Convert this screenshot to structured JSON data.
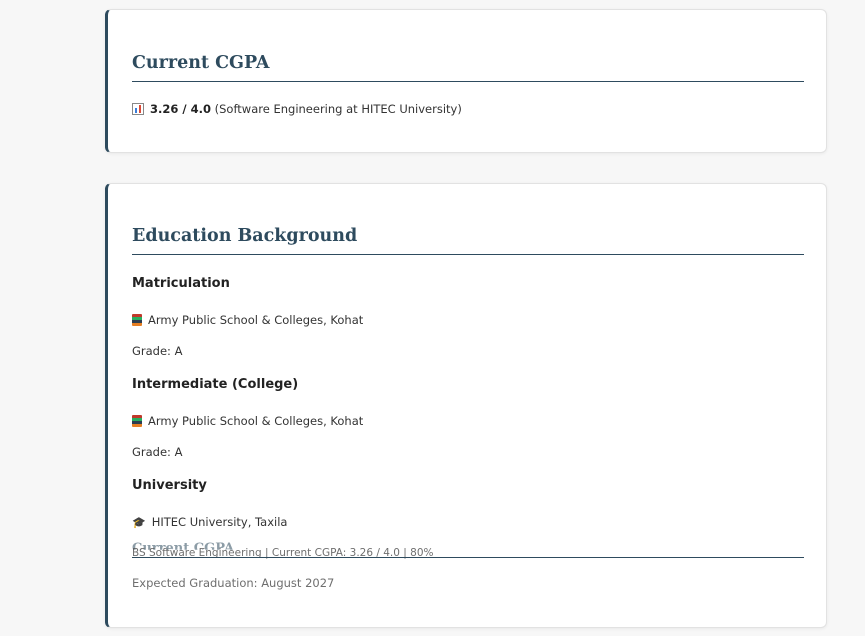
{
  "cgpa_card": {
    "title": "Current CGPA",
    "value": "3.26 / 4.0",
    "detail": "(Software Engineering at HITEC University)"
  },
  "education_card": {
    "title": "Education Background",
    "matriculation": {
      "heading": "Matriculation",
      "school": "Army Public School & Colleges, Kohat",
      "grade": "Grade: A"
    },
    "intermediate": {
      "heading": "Intermediate (College)",
      "school": "Army Public School & Colleges, Kohat",
      "grade": "Grade: A"
    },
    "university": {
      "heading": "University",
      "school": "HITEC University, Taxila",
      "overlap_heading": "Current CGPA",
      "program_line": "BS Software Engineering | Current CGPA: 3.26 / 4.0 | 80%",
      "graduation": "Expected Graduation: August 2027"
    }
  },
  "icons": {
    "cgpa": "bar-chart-icon",
    "school": "books-icon",
    "university": "graduation-cap-icon"
  },
  "colors": {
    "accent": "#2e4b5e",
    "background": "#f7f7f7",
    "card": "#ffffff"
  }
}
